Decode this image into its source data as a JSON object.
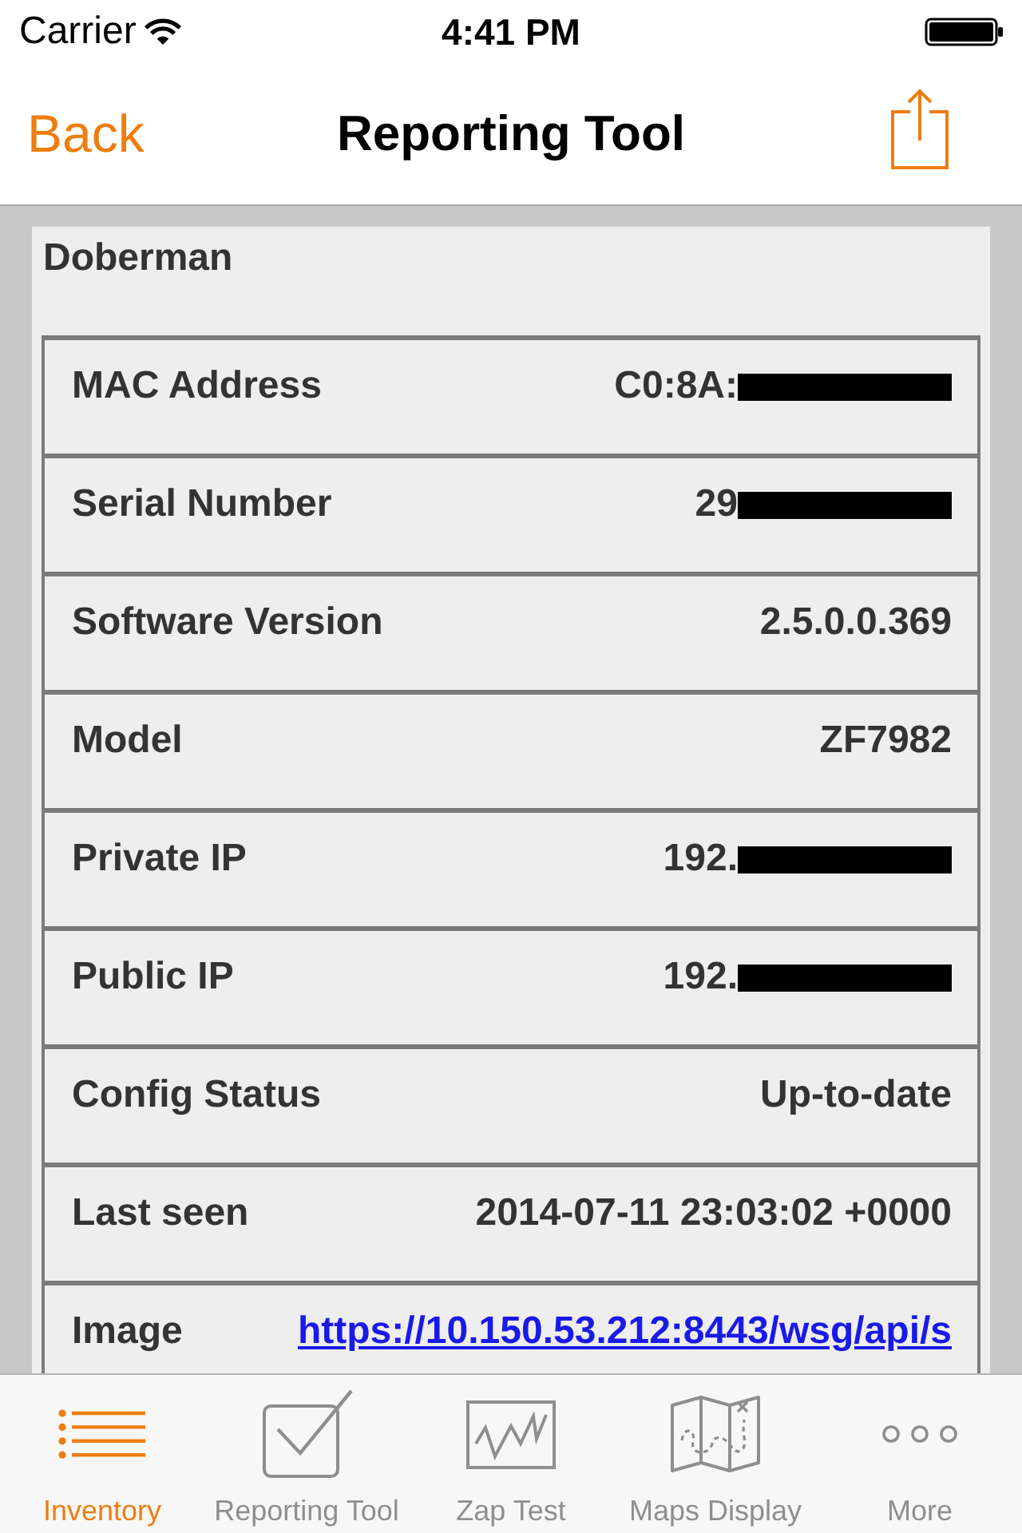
{
  "status_bar": {
    "carrier": "Carrier",
    "time": "4:41 PM"
  },
  "nav_bar": {
    "back": "Back",
    "title": "Reporting Tool"
  },
  "device": {
    "name": "Doberman",
    "rows": [
      {
        "label": "MAC Address",
        "value": "C0:8A:",
        "kind": "text",
        "redacted": true
      },
      {
        "label": "Serial Number",
        "value": "29",
        "kind": "text",
        "redacted": true
      },
      {
        "label": "Software Version",
        "value": "2.5.0.0.369",
        "kind": "text",
        "redacted": false
      },
      {
        "label": "Model",
        "value": "ZF7982",
        "kind": "text",
        "redacted": false
      },
      {
        "label": "Private IP",
        "value": "192.",
        "kind": "text",
        "redacted": true
      },
      {
        "label": "Public IP",
        "value": "192.",
        "kind": "text",
        "redacted": true
      },
      {
        "label": "Config Status",
        "value": "Up-to-date",
        "kind": "text",
        "redacted": false
      },
      {
        "label": "Last seen",
        "value": "2014-07-11 23:03:02 +0000",
        "kind": "text",
        "redacted": false
      },
      {
        "label": "Image",
        "value": "https://10.150.53.212:8443/wsg/api/s",
        "kind": "link",
        "redacted": false
      }
    ]
  },
  "tab_bar": {
    "tabs": [
      {
        "label": "Inventory",
        "selected": true
      },
      {
        "label": "Reporting Tool",
        "selected": false
      },
      {
        "label": "Zap Test",
        "selected": false
      },
      {
        "label": "Maps Display",
        "selected": false
      },
      {
        "label": "More",
        "selected": false
      }
    ]
  }
}
